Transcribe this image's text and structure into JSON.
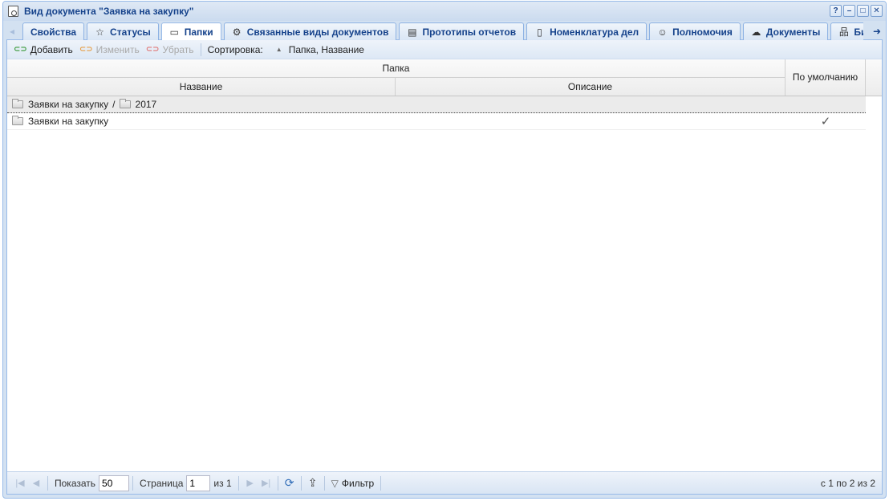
{
  "window": {
    "title": "Вид документа \"Заявка на закупку\"",
    "tools": [
      "?",
      "–",
      "□",
      "✕"
    ]
  },
  "tabs": [
    {
      "label": "Свойства",
      "icon": "none",
      "glyph": ""
    },
    {
      "label": "Статусы",
      "icon": "star-icon",
      "glyph": "☆"
    },
    {
      "label": "Папки",
      "icon": "folder-icon",
      "glyph": "▭",
      "active": true
    },
    {
      "label": "Связанные виды документов",
      "icon": "linked-doc-icon",
      "glyph": "⚙"
    },
    {
      "label": "Прототипы отчетов",
      "icon": "report-icon",
      "glyph": "▤"
    },
    {
      "label": "Номенклатура дел",
      "icon": "registry-icon",
      "glyph": "▯"
    },
    {
      "label": "Полномочия",
      "icon": "user-key-icon",
      "glyph": "☺"
    },
    {
      "label": "Документы",
      "icon": "cloud-doc-icon",
      "glyph": "☁"
    },
    {
      "label": "Бизнес-",
      "icon": "org-chart-icon",
      "glyph": "品"
    }
  ],
  "toolbar": {
    "add_label": "Добавить",
    "edit_label": "Изменить",
    "remove_label": "Убрать",
    "sort_label": "Сортировка:",
    "sort_value": "Папка, Название"
  },
  "grid": {
    "group_header": "Папка",
    "col_name": "Название",
    "col_desc": "Описание",
    "col_default": "По умолчанию",
    "rows": [
      {
        "path": [
          "Заявки на закупку",
          "2017"
        ],
        "separator": "/",
        "description": "",
        "default": ""
      },
      {
        "path": [
          "Заявки на закупку"
        ],
        "separator": "",
        "description": "",
        "default": "✓"
      }
    ]
  },
  "pager": {
    "show_label": "Показать",
    "page_size": "50",
    "page_label": "Страница",
    "page_value": "1",
    "of_label": "из 1",
    "filter_label": "Фильтр",
    "info": "с 1 по 2 из 2"
  }
}
